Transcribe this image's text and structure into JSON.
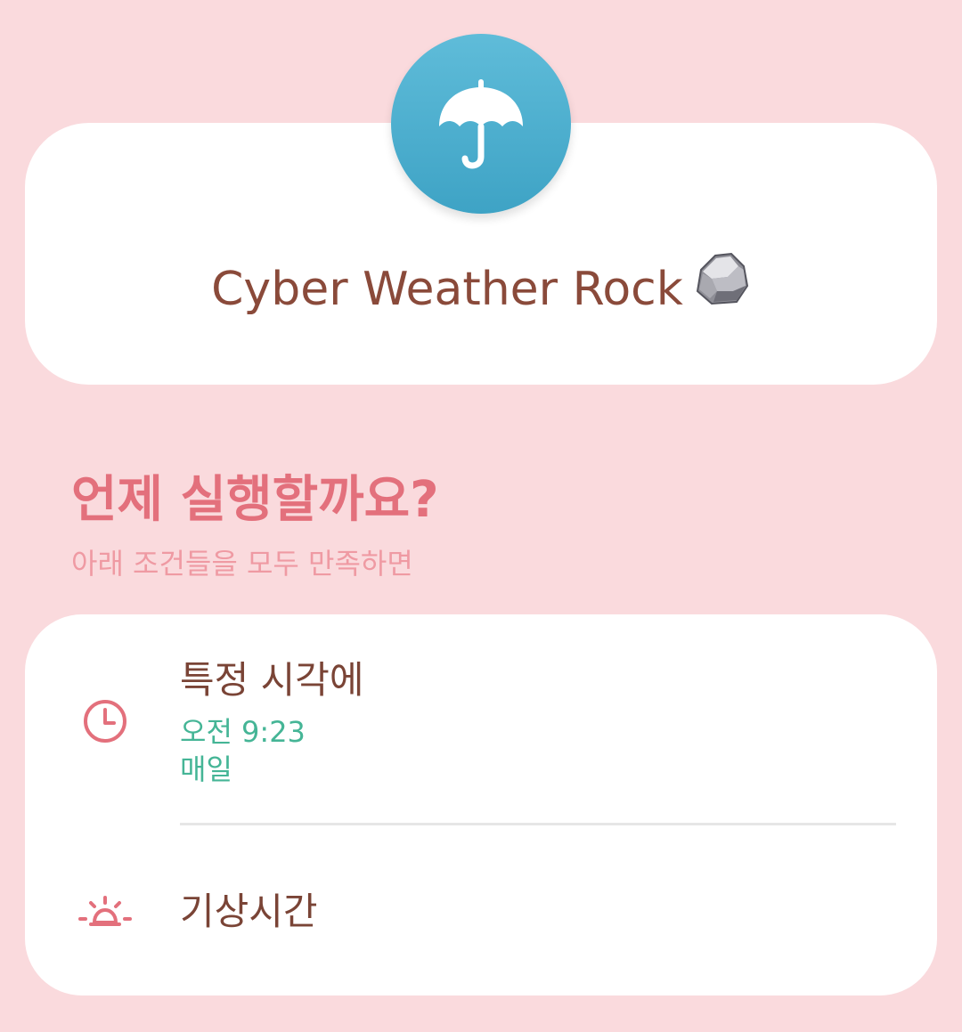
{
  "app": {
    "title": "Cyber Weather Rock",
    "icon": "umbrella-icon",
    "title_emoji": "rock-icon",
    "accent_color": "#4fb0d0"
  },
  "section": {
    "title": "언제 실행할까요?",
    "subtitle": "아래 조건들을 모두 만족하면"
  },
  "conditions": [
    {
      "icon": "clock-icon",
      "title": "특정 시각에",
      "time": "오전 9:23",
      "repeat": "매일"
    },
    {
      "icon": "sunrise-icon",
      "title": "기상시간"
    }
  ],
  "colors": {
    "background": "#fadadd",
    "card": "#ffffff",
    "title_text": "#8a4a3a",
    "section_title": "#e3707c",
    "detail_text": "#45b596"
  }
}
